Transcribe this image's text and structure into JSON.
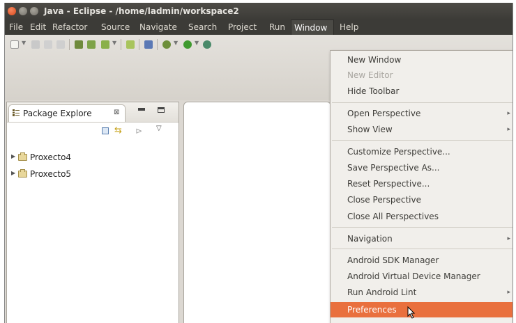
{
  "window": {
    "title": "Java - Eclipse - /home/ladmin/workspace2"
  },
  "menubar": {
    "items": [
      "File",
      "Edit",
      "Refactor",
      "Source",
      "Navigate",
      "Search",
      "Project",
      "Run",
      "Window",
      "Help"
    ],
    "active": "Window"
  },
  "explorer": {
    "tab_label": "Package Explore",
    "tab_close": "⊠",
    "projects": [
      "Proxecto4",
      "Proxecto5"
    ]
  },
  "window_menu": {
    "items": [
      {
        "label": "New Window",
        "enabled": true,
        "submenu": false
      },
      {
        "label": "New Editor",
        "enabled": false,
        "submenu": false
      },
      {
        "label": "Hide Toolbar",
        "enabled": true,
        "submenu": false
      },
      {
        "label": "Open Perspective",
        "enabled": true,
        "submenu": true
      },
      {
        "label": "Show View",
        "enabled": true,
        "submenu": true
      },
      {
        "label": "Customize Perspective...",
        "enabled": true,
        "submenu": false
      },
      {
        "label": "Save Perspective As...",
        "enabled": true,
        "submenu": false
      },
      {
        "label": "Reset Perspective...",
        "enabled": true,
        "submenu": false
      },
      {
        "label": "Close Perspective",
        "enabled": true,
        "submenu": false
      },
      {
        "label": "Close All Perspectives",
        "enabled": true,
        "submenu": false
      },
      {
        "label": "Navigation",
        "enabled": true,
        "submenu": true
      },
      {
        "label": "Android SDK Manager",
        "enabled": true,
        "submenu": false
      },
      {
        "label": "Android Virtual Device Manager",
        "enabled": true,
        "submenu": false
      },
      {
        "label": "Run Android Lint",
        "enabled": true,
        "submenu": true
      },
      {
        "label": "Preferences",
        "enabled": true,
        "submenu": false,
        "highlighted": true
      }
    ]
  },
  "colors": {
    "menu_highlight": "#e9703e",
    "title_bar": "#3c3b37",
    "close_button": "#e0582a"
  },
  "icons": {
    "toolbar": [
      "new-icon",
      "save-icon",
      "print-icon",
      "debug-icon",
      "run-icon",
      "search-icon"
    ],
    "cursor": "mouse-pointer-icon"
  }
}
